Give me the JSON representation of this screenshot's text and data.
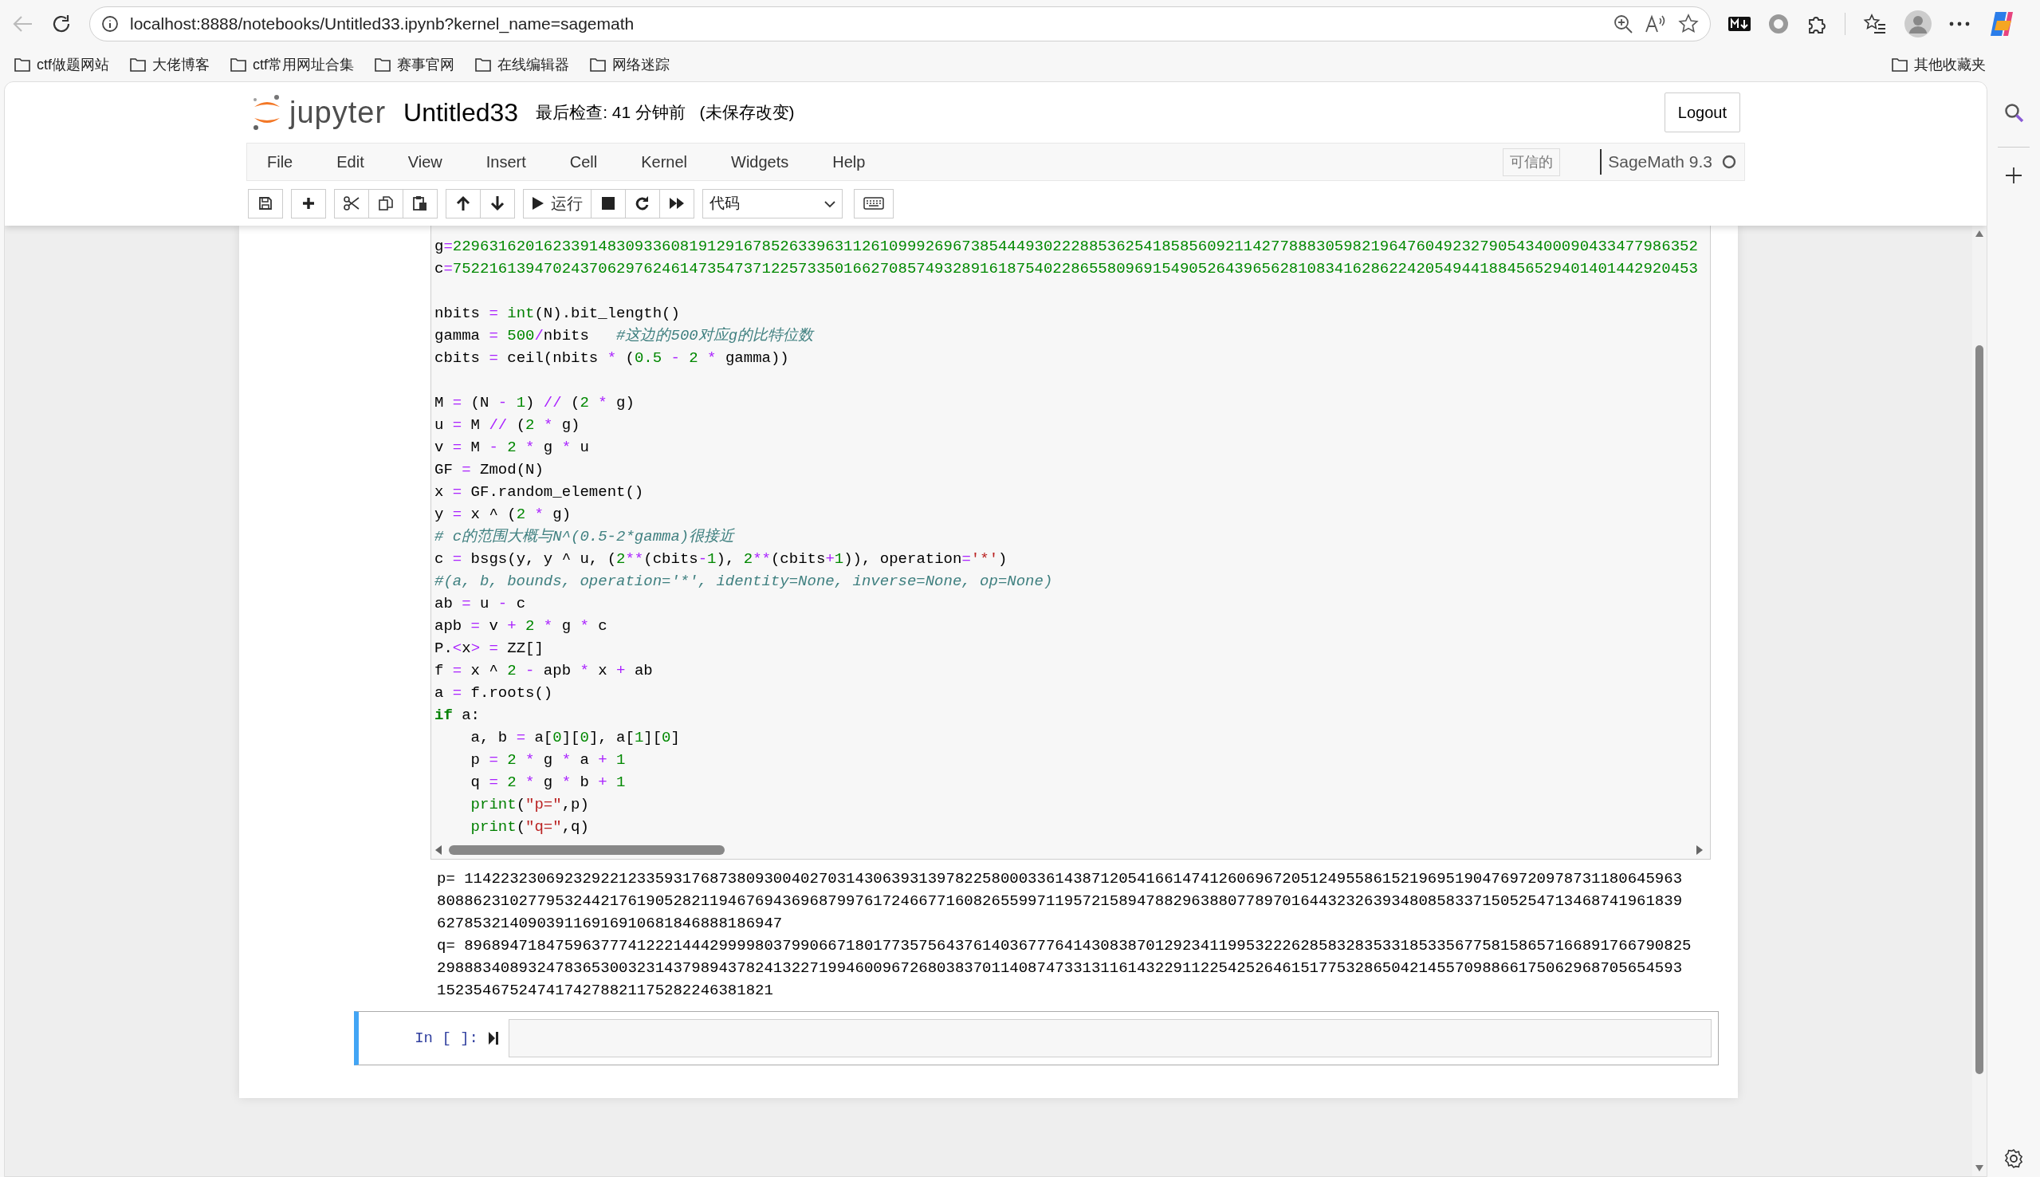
{
  "browser": {
    "url": "localhost:8888/notebooks/Untitled33.ipynb?kernel_name=sagemath",
    "bookmarks": [
      "ctf做题网站",
      "大佬博客",
      "ctf常用网址合集",
      "赛事官网",
      "在线编辑器",
      "网络迷踪"
    ],
    "other_bookmarks": "其他收藏夹"
  },
  "header": {
    "logo_text": "jupyter",
    "notebook_name": "Untitled33",
    "checkpoint": "最后检查: 41 分钟前",
    "unsaved": "(未保存改变)",
    "logout": "Logout"
  },
  "menubar": {
    "items": [
      "File",
      "Edit",
      "View",
      "Insert",
      "Cell",
      "Kernel",
      "Widgets",
      "Help"
    ],
    "trusted": "可信的",
    "kernel_name": "SageMath 9.3",
    "kernel_busy": false
  },
  "toolbar": {
    "run_label": "运行",
    "cell_type": "代码"
  },
  "code_blocks": [
    [
      [
        {
          "kind": "text",
          "text": "g"
        },
        {
          "kind": "op",
          "text": "="
        },
        {
          "kind": "num",
          "text": "22963162016233914830933608191291678526339631126109992696738544493022288536254185856092114277888305982196476049232790543400090433477986352"
        }
      ],
      [
        {
          "kind": "text",
          "text": "c"
        },
        {
          "kind": "op",
          "text": "="
        },
        {
          "kind": "num",
          "text": "75221613947024370629762461473547371225733501662708574932891618754022865580969154905264396562810834162862242054944188456529401401442920453"
        }
      ]
    ],
    [
      [
        {
          "kind": "text",
          "text": "nbits "
        },
        {
          "kind": "op",
          "text": "= "
        },
        {
          "kind": "builtin",
          "text": "int"
        },
        {
          "kind": "text",
          "text": "(N).bit_length()"
        }
      ],
      [
        {
          "kind": "text",
          "text": "gamma "
        },
        {
          "kind": "op",
          "text": "= "
        },
        {
          "kind": "num",
          "text": "500"
        },
        {
          "kind": "op",
          "text": "/"
        },
        {
          "kind": "text",
          "text": "nbits   "
        },
        {
          "kind": "comment",
          "text": "#这边的500对应g的比特位数"
        }
      ],
      [
        {
          "kind": "text",
          "text": "cbits "
        },
        {
          "kind": "op",
          "text": "="
        },
        {
          "kind": "text",
          "text": " ceil(nbits "
        },
        {
          "kind": "op",
          "text": "*"
        },
        {
          "kind": "text",
          "text": " ("
        },
        {
          "kind": "num",
          "text": "0.5 "
        },
        {
          "kind": "op",
          "text": "- "
        },
        {
          "kind": "num",
          "text": "2 "
        },
        {
          "kind": "op",
          "text": "* "
        },
        {
          "kind": "text",
          "text": "gamma))"
        }
      ]
    ],
    [
      [
        {
          "kind": "text",
          "text": "M "
        },
        {
          "kind": "op",
          "text": "="
        },
        {
          "kind": "text",
          "text": " (N "
        },
        {
          "kind": "op",
          "text": "- "
        },
        {
          "kind": "num",
          "text": "1"
        },
        {
          "kind": "text",
          "text": ") "
        },
        {
          "kind": "op",
          "text": "//"
        },
        {
          "kind": "text",
          "text": " ("
        },
        {
          "kind": "num",
          "text": "2 "
        },
        {
          "kind": "op",
          "text": "* "
        },
        {
          "kind": "text",
          "text": "g)"
        }
      ],
      [
        {
          "kind": "text",
          "text": "u "
        },
        {
          "kind": "op",
          "text": "="
        },
        {
          "kind": "text",
          "text": " M "
        },
        {
          "kind": "op",
          "text": "//"
        },
        {
          "kind": "text",
          "text": " ("
        },
        {
          "kind": "num",
          "text": "2 "
        },
        {
          "kind": "op",
          "text": "* "
        },
        {
          "kind": "text",
          "text": "g)"
        }
      ],
      [
        {
          "kind": "text",
          "text": "v "
        },
        {
          "kind": "op",
          "text": "="
        },
        {
          "kind": "text",
          "text": " M "
        },
        {
          "kind": "op",
          "text": "- "
        },
        {
          "kind": "num",
          "text": "2 "
        },
        {
          "kind": "op",
          "text": "*"
        },
        {
          "kind": "text",
          "text": " g "
        },
        {
          "kind": "op",
          "text": "*"
        },
        {
          "kind": "text",
          "text": " u"
        }
      ],
      [
        {
          "kind": "text",
          "text": "GF "
        },
        {
          "kind": "op",
          "text": "="
        },
        {
          "kind": "text",
          "text": " Zmod(N)"
        }
      ],
      [
        {
          "kind": "text",
          "text": "x "
        },
        {
          "kind": "op",
          "text": "="
        },
        {
          "kind": "text",
          "text": " GF.random_element()"
        }
      ],
      [
        {
          "kind": "text",
          "text": "y "
        },
        {
          "kind": "op",
          "text": "="
        },
        {
          "kind": "text",
          "text": " x ^ ("
        },
        {
          "kind": "num",
          "text": "2 "
        },
        {
          "kind": "op",
          "text": "* "
        },
        {
          "kind": "text",
          "text": "g)"
        }
      ],
      [
        {
          "kind": "comment",
          "text": "# c的范围大概与N^(0.5-2*gamma)很接近"
        }
      ],
      [
        {
          "kind": "text",
          "text": "c "
        },
        {
          "kind": "op",
          "text": "="
        },
        {
          "kind": "text",
          "text": " bsgs(y, y ^ u, ("
        },
        {
          "kind": "num",
          "text": "2"
        },
        {
          "kind": "op",
          "text": "**"
        },
        {
          "kind": "text",
          "text": "(cbits"
        },
        {
          "kind": "op",
          "text": "-"
        },
        {
          "kind": "num",
          "text": "1"
        },
        {
          "kind": "text",
          "text": "), "
        },
        {
          "kind": "num",
          "text": "2"
        },
        {
          "kind": "op",
          "text": "**"
        },
        {
          "kind": "text",
          "text": "(cbits"
        },
        {
          "kind": "op",
          "text": "+"
        },
        {
          "kind": "num",
          "text": "1"
        },
        {
          "kind": "text",
          "text": ")), operation"
        },
        {
          "kind": "op",
          "text": "="
        },
        {
          "kind": "string",
          "text": "'*'"
        },
        {
          "kind": "text",
          "text": ")"
        }
      ],
      [
        {
          "kind": "comment",
          "text": "#(a, b, bounds, operation='*', identity=None, inverse=None, op=None)"
        }
      ],
      [
        {
          "kind": "text",
          "text": "ab "
        },
        {
          "kind": "op",
          "text": "="
        },
        {
          "kind": "text",
          "text": " u "
        },
        {
          "kind": "op",
          "text": "-"
        },
        {
          "kind": "text",
          "text": " c"
        }
      ],
      [
        {
          "kind": "text",
          "text": "apb "
        },
        {
          "kind": "op",
          "text": "="
        },
        {
          "kind": "text",
          "text": " v "
        },
        {
          "kind": "op",
          "text": "+ "
        },
        {
          "kind": "num",
          "text": "2 "
        },
        {
          "kind": "op",
          "text": "*"
        },
        {
          "kind": "text",
          "text": " g "
        },
        {
          "kind": "op",
          "text": "*"
        },
        {
          "kind": "text",
          "text": " c"
        }
      ],
      [
        {
          "kind": "text",
          "text": "P."
        },
        {
          "kind": "op",
          "text": "<"
        },
        {
          "kind": "text",
          "text": "x"
        },
        {
          "kind": "op",
          "text": "> ="
        },
        {
          "kind": "text",
          "text": " ZZ[]"
        }
      ],
      [
        {
          "kind": "text",
          "text": "f "
        },
        {
          "kind": "op",
          "text": "="
        },
        {
          "kind": "text",
          "text": " x ^ "
        },
        {
          "kind": "num",
          "text": "2 "
        },
        {
          "kind": "op",
          "text": "-"
        },
        {
          "kind": "text",
          "text": " apb "
        },
        {
          "kind": "op",
          "text": "*"
        },
        {
          "kind": "text",
          "text": " x "
        },
        {
          "kind": "op",
          "text": "+"
        },
        {
          "kind": "text",
          "text": " ab"
        }
      ],
      [
        {
          "kind": "text",
          "text": "a "
        },
        {
          "kind": "op",
          "text": "="
        },
        {
          "kind": "text",
          "text": " f.roots()"
        }
      ],
      [
        {
          "kind": "keyword",
          "text": "if"
        },
        {
          "kind": "text",
          "text": " a:"
        }
      ],
      [
        {
          "kind": "text",
          "text": "    a, b "
        },
        {
          "kind": "op",
          "text": "="
        },
        {
          "kind": "text",
          "text": " a["
        },
        {
          "kind": "num",
          "text": "0"
        },
        {
          "kind": "text",
          "text": "]["
        },
        {
          "kind": "num",
          "text": "0"
        },
        {
          "kind": "text",
          "text": "], a["
        },
        {
          "kind": "num",
          "text": "1"
        },
        {
          "kind": "text",
          "text": "]["
        },
        {
          "kind": "num",
          "text": "0"
        },
        {
          "kind": "text",
          "text": "]"
        }
      ],
      [
        {
          "kind": "text",
          "text": "    p "
        },
        {
          "kind": "op",
          "text": "= "
        },
        {
          "kind": "num",
          "text": "2 "
        },
        {
          "kind": "op",
          "text": "*"
        },
        {
          "kind": "text",
          "text": " g "
        },
        {
          "kind": "op",
          "text": "*"
        },
        {
          "kind": "text",
          "text": " a "
        },
        {
          "kind": "op",
          "text": "+ "
        },
        {
          "kind": "num",
          "text": "1"
        }
      ],
      [
        {
          "kind": "text",
          "text": "    q "
        },
        {
          "kind": "op",
          "text": "= "
        },
        {
          "kind": "num",
          "text": "2 "
        },
        {
          "kind": "op",
          "text": "*"
        },
        {
          "kind": "text",
          "text": " g "
        },
        {
          "kind": "op",
          "text": "*"
        },
        {
          "kind": "text",
          "text": " b "
        },
        {
          "kind": "op",
          "text": "+ "
        },
        {
          "kind": "num",
          "text": "1"
        }
      ],
      [
        {
          "kind": "builtin",
          "text": "    print"
        },
        {
          "kind": "text",
          "text": "("
        },
        {
          "kind": "string",
          "text": "\"p=\""
        },
        {
          "kind": "text",
          "text": ",p)"
        }
      ],
      [
        {
          "kind": "builtin",
          "text": "    print"
        },
        {
          "kind": "text",
          "text": "("
        },
        {
          "kind": "string",
          "text": "\"q=\""
        },
        {
          "kind": "text",
          "text": ",q)"
        }
      ]
    ]
  ],
  "output_lines": [
    "p= 11422323069232922123359317687380930040270314306393139782258000336143871205416614741260696720512495586152196951904769720978731180645963",
    "80886231027795324421761905282119467694369687997617246677160826559971195721589478829638807789701644323263934808583371505254713468741961839",
    "62785321409039116916910681846888186947",
    "q= 896894718475963777412221444299998037990667180177357564376140367776414308387012923411995322262858328353318533567758158657166891766790825",
    "29888340893247836530032314379894378241322719946009672680383701140874733131161432291122542526461517753286504214557098866175062968705654593",
    "1523546752474174278821175282246381821"
  ],
  "new_cell": {
    "prompt": "In [ ]:"
  }
}
